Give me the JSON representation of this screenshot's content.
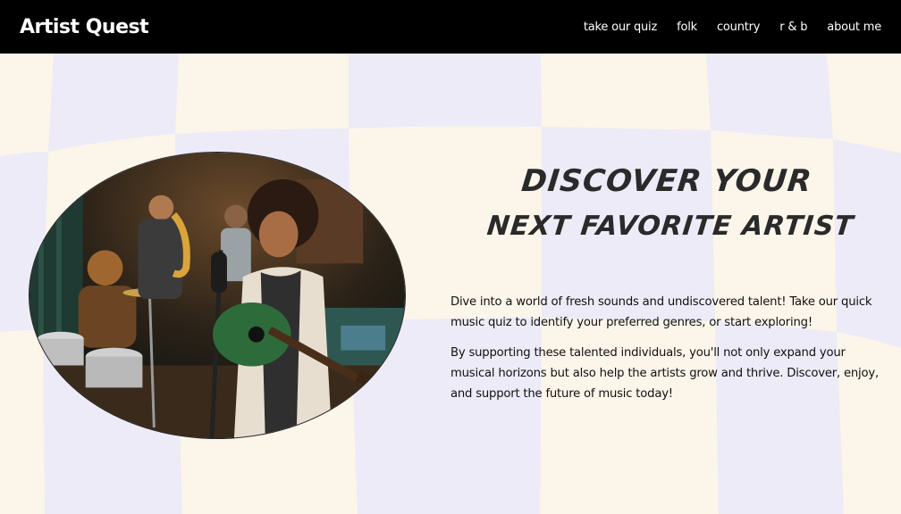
{
  "navbar": {
    "brand": "Artist Quest",
    "links": [
      "take our quiz",
      "folk",
      "country",
      "r & b",
      "about me"
    ]
  },
  "hero": {
    "headline_line1": "Discover your",
    "headline_line2": "next favorite artist",
    "paragraph1": "Dive into a world of fresh sounds and undiscovered talent! Take our quick music quiz to identify your preferred genres, or start exploring!",
    "paragraph2": "By supporting these talented individuals, you'll not only expand your musical horizons but also help the artists grow and thrive. Discover, enjoy, and support the future of music today!",
    "image_icon": "band-photo-icon"
  },
  "colors": {
    "nav_bg": "#000000",
    "cream": "#fcf5ea",
    "lavender": "#ecebf7",
    "text": "#2a2a2a"
  }
}
